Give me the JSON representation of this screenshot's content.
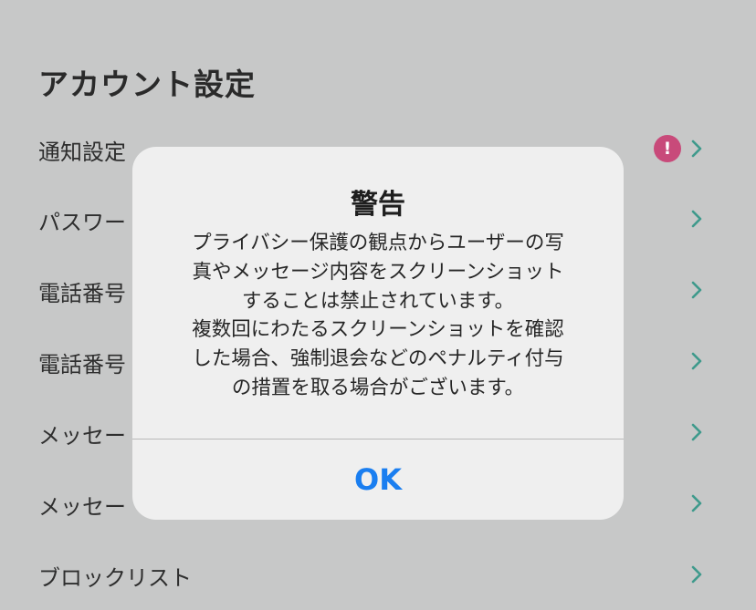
{
  "header": {
    "title": "アカウント設定"
  },
  "settings": {
    "rows": [
      {
        "label": "通知設定",
        "badge": "!",
        "chevron_icon": "chevron-right-icon"
      },
      {
        "label": "パスワー",
        "chevron_icon": "chevron-right-icon"
      },
      {
        "label": "電話番号",
        "chevron_icon": "chevron-right-icon"
      },
      {
        "label": "電話番号",
        "chevron_icon": "chevron-right-icon"
      },
      {
        "label": "メッセー",
        "chevron_icon": "chevron-right-icon"
      },
      {
        "label": "メッセー",
        "chevron_icon": "chevron-right-icon"
      },
      {
        "label": "ブロックリスト",
        "chevron_icon": "chevron-right-icon"
      }
    ]
  },
  "dialog": {
    "title": "警告",
    "message_lines": [
      "プライバシー保護の観点からユーザーの写",
      "真やメッセージ内容をスクリーンショット",
      "することは禁止されています。",
      "複数回にわたるスクリーンショットを確認",
      "した場合、強制退会などのペナルティ付与",
      "の措置を取る場合がございます。"
    ],
    "ok_label": "OK"
  },
  "colors": {
    "background": "#c7c8c8",
    "dialog_background": "#efefef",
    "chevron": "#3f9a8c",
    "badge": "#c84a7a",
    "ok_button": "#1a7ef0"
  }
}
